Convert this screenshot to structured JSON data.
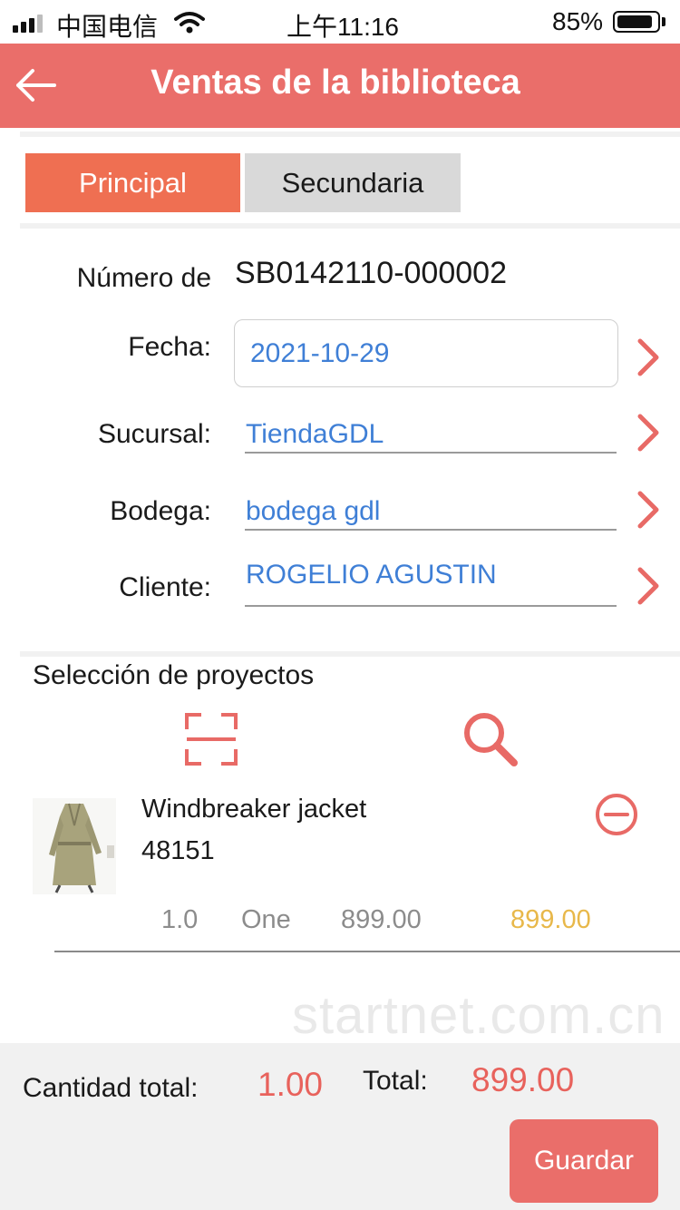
{
  "status_bar": {
    "carrier": "中国电信",
    "time": "上午11:16",
    "battery": "85%",
    "battery_level": 0.85,
    "icons": [
      "signal-icon",
      "wifi-icon",
      "battery-icon"
    ]
  },
  "header": {
    "title": "Ventas de la biblioteca",
    "back_icon": "arrow-left-icon"
  },
  "tabs": [
    {
      "label": "Principal",
      "active": true
    },
    {
      "label": "Secundaria",
      "active": false
    }
  ],
  "form": {
    "number_label": "Número de",
    "number_value": "SB0142110-000002",
    "date_label": "Fecha:",
    "date_value": "2021-10-29",
    "branch_label": "Sucursal:",
    "branch_value": "TiendaGDL",
    "warehouse_label": "Bodega:",
    "warehouse_value": "bodega gdl",
    "client_label": "Cliente:",
    "client_value": "ROGELIO AGUSTIN"
  },
  "products": {
    "title": "Selección de proyectos",
    "tools": [
      "scan-icon",
      "search-icon"
    ],
    "items": [
      {
        "name": "Windbreaker jacket",
        "code": "48151",
        "quantity": "1.0",
        "unit": "One",
        "price": "899.00",
        "subtotal": "899.00",
        "image": "trench-coat-photo"
      }
    ]
  },
  "watermark": "startnet.com.cn",
  "footer": {
    "qty_label": "Cantidad total:",
    "qty_value": "1.00",
    "total_label": "Total:",
    "total_value": "899.00",
    "save_label": "Guardar"
  },
  "colors": {
    "brand": "#ea6e6a",
    "tab_active": "#ef6f52",
    "value_blue": "#3f7fd6",
    "subtotal": "#e8b84a",
    "total_red": "#e8625c"
  }
}
